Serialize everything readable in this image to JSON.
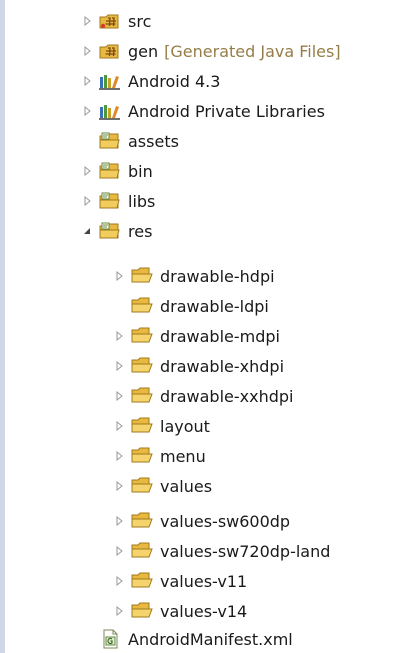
{
  "tree": {
    "items": [
      {
        "label": "src",
        "decoration": "",
        "icon": "source-folder-icon",
        "toggle": "collapsed"
      },
      {
        "label": "gen",
        "decoration": "[Generated Java Files]",
        "icon": "source-folder-icon",
        "toggle": "collapsed"
      },
      {
        "label": "Android 4.3",
        "decoration": "",
        "icon": "library-icon",
        "toggle": "collapsed"
      },
      {
        "label": "Android Private Libraries",
        "decoration": "",
        "icon": "library-icon",
        "toggle": "collapsed"
      },
      {
        "label": "assets",
        "decoration": "",
        "icon": "package-folder-icon",
        "toggle": "none"
      },
      {
        "label": "bin",
        "decoration": "",
        "icon": "package-folder-icon",
        "toggle": "collapsed"
      },
      {
        "label": "libs",
        "decoration": "",
        "icon": "package-folder-icon",
        "toggle": "collapsed"
      },
      {
        "label": "res",
        "decoration": "",
        "icon": "package-folder-icon",
        "toggle": "expanded"
      },
      {
        "label": "drawable-hdpi",
        "decoration": "",
        "icon": "folder-icon",
        "toggle": "collapsed"
      },
      {
        "label": "drawable-ldpi",
        "decoration": "",
        "icon": "folder-icon",
        "toggle": "none"
      },
      {
        "label": "drawable-mdpi",
        "decoration": "",
        "icon": "folder-icon",
        "toggle": "collapsed"
      },
      {
        "label": "drawable-xhdpi",
        "decoration": "",
        "icon": "folder-icon",
        "toggle": "collapsed"
      },
      {
        "label": "drawable-xxhdpi",
        "decoration": "",
        "icon": "folder-icon",
        "toggle": "collapsed"
      },
      {
        "label": "layout",
        "decoration": "",
        "icon": "folder-icon",
        "toggle": "collapsed"
      },
      {
        "label": "menu",
        "decoration": "",
        "icon": "folder-icon",
        "toggle": "collapsed"
      },
      {
        "label": "values",
        "decoration": "",
        "icon": "folder-icon",
        "toggle": "collapsed"
      },
      {
        "label": "values-sw600dp",
        "decoration": "",
        "icon": "folder-icon",
        "toggle": "collapsed"
      },
      {
        "label": "values-sw720dp-land",
        "decoration": "",
        "icon": "folder-icon",
        "toggle": "collapsed"
      },
      {
        "label": "values-v11",
        "decoration": "",
        "icon": "folder-icon",
        "toggle": "collapsed"
      },
      {
        "label": "values-v14",
        "decoration": "",
        "icon": "folder-icon",
        "toggle": "collapsed"
      },
      {
        "label": "AndroidManifest.xml",
        "decoration": "",
        "icon": "xml-file-icon",
        "toggle": "none"
      }
    ]
  },
  "colors": {
    "label": "#1a1a1a",
    "decoration": "#957d47",
    "folder": "#e8b840",
    "twisty": "#9a9a9a"
  }
}
